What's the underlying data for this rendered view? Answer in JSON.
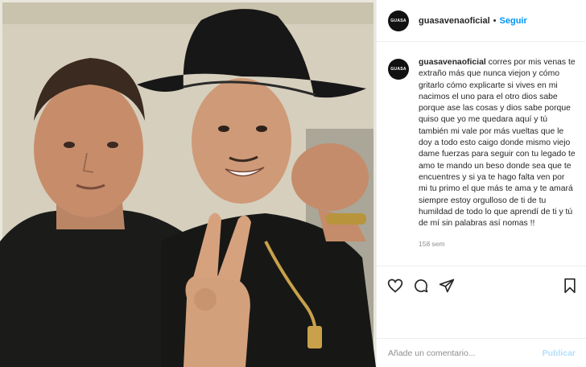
{
  "post": {
    "username": "guasavenaoficial",
    "avatar_text": "GUASA",
    "follow_label": "Seguir",
    "separator": "•",
    "caption_user": "guasavenaoficial",
    "caption_text": "corres por mis venas te extraño más que nunca viejon y cómo gritarlo cómo explicarte si vives en mi nacimos el uno para el otro dios sabe porque ase las cosas y dios sabe porque quiso que yo me quedara aquí y tú también mi vale por más vueltas que le doy a todo esto caigo donde mismo viejo dame fuerzas para seguir con tu legado te amo te mando un beso donde sea que te encuentres y si ya te hago falta ven por mi tu primo el que más te ama y te amará siempre estoy orgulloso de ti de tu humildad de todo lo que aprendí de ti y tú de mí sin palabras así nomas !!",
    "age": "158 sem"
  },
  "actions": {
    "like_icon": "heart-icon",
    "comment_icon": "comment-icon",
    "share_icon": "share-icon",
    "save_icon": "bookmark-icon"
  },
  "comment": {
    "placeholder": "Añade un comentario...",
    "post_label": "Publicar"
  },
  "colors": {
    "link_blue": "#0095f6",
    "disabled_blue": "#b2dffc",
    "text": "#262626",
    "muted": "#8e8e8e",
    "border": "#efefef"
  }
}
